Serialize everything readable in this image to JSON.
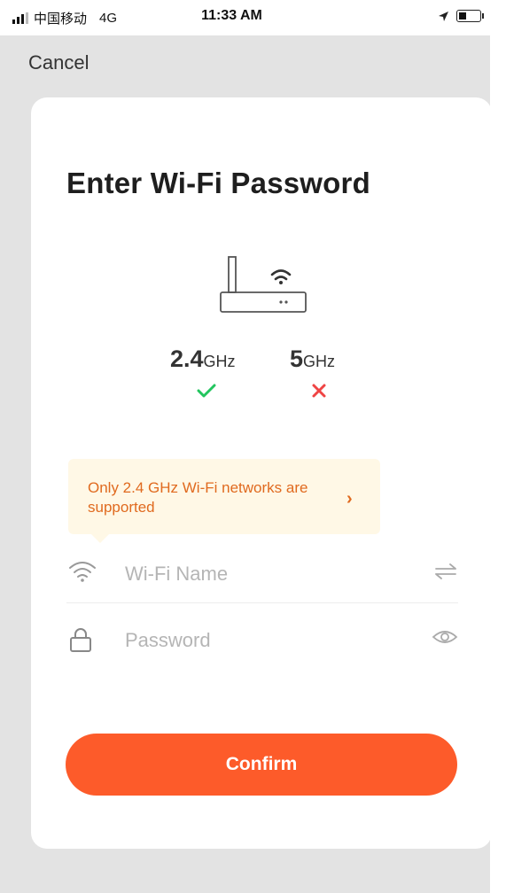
{
  "status_bar": {
    "carrier": "中国移动",
    "network": "4G",
    "time": "11:33 AM"
  },
  "nav": {
    "cancel_label": "Cancel"
  },
  "page": {
    "title": "Enter Wi-Fi Password"
  },
  "bands": {
    "band_24": {
      "value": "2.4",
      "unit": "GHz",
      "supported": true
    },
    "band_5": {
      "value": "5",
      "unit": "GHz",
      "supported": false
    }
  },
  "notice": {
    "text": "Only 2.4 GHz Wi-Fi networks are supported"
  },
  "fields": {
    "wifi_name": {
      "value": "",
      "placeholder": "Wi-Fi Name"
    },
    "password": {
      "value": "",
      "placeholder": "Password"
    }
  },
  "confirm_label": "Confirm",
  "colors": {
    "accent": "#fd5b2a",
    "check": "#22c55e",
    "cross": "#ef4444",
    "notice_bg": "#fff8e6",
    "notice_text": "#e06a1f"
  },
  "icons": {
    "status_location": "location-arrow-icon",
    "status_battery": "battery-icon",
    "router": "router-icon",
    "wifi_field": "wifi-icon",
    "password_field": "lock-icon",
    "switch_network": "swap-arrows-icon",
    "show_password": "eye-icon"
  }
}
